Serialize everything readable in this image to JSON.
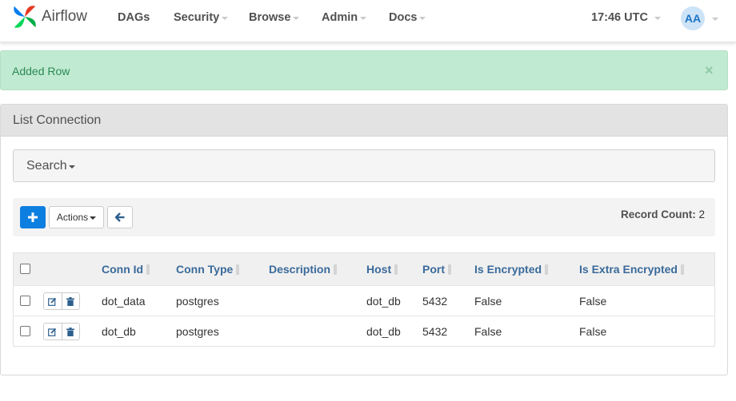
{
  "brand": {
    "name": "Airflow"
  },
  "nav": {
    "dags": "DAGs",
    "security": "Security",
    "browse": "Browse",
    "admin": "Admin",
    "docs": "Docs",
    "time": "17:46 UTC",
    "user_initials": "AA"
  },
  "alert": {
    "message": "Added Row",
    "close": "×"
  },
  "panel": {
    "title": "List Connection",
    "search_label": "Search",
    "actions_label": "Actions",
    "add_icon": "plus-icon",
    "back_icon": "arrow-left-icon",
    "record_count_label": "Record Count:",
    "record_count_value": "2"
  },
  "table": {
    "columns": [
      "Conn Id",
      "Conn Type",
      "Description",
      "Host",
      "Port",
      "Is Encrypted",
      "Is Extra Encrypted"
    ],
    "rows": [
      {
        "conn_id": "dot_data",
        "conn_type": "postgres",
        "description": "",
        "host": "dot_db",
        "port": "5432",
        "is_encrypted": "False",
        "is_extra_encrypted": "False"
      },
      {
        "conn_id": "dot_db",
        "conn_type": "postgres",
        "description": "",
        "host": "dot_db",
        "port": "5432",
        "is_encrypted": "False",
        "is_extra_encrypted": "False"
      }
    ]
  },
  "colors": {
    "accent": "#0d7fe0",
    "success_bg": "#c1ead2",
    "success_text": "#2a8a52",
    "header_link": "#3a6a9a"
  }
}
